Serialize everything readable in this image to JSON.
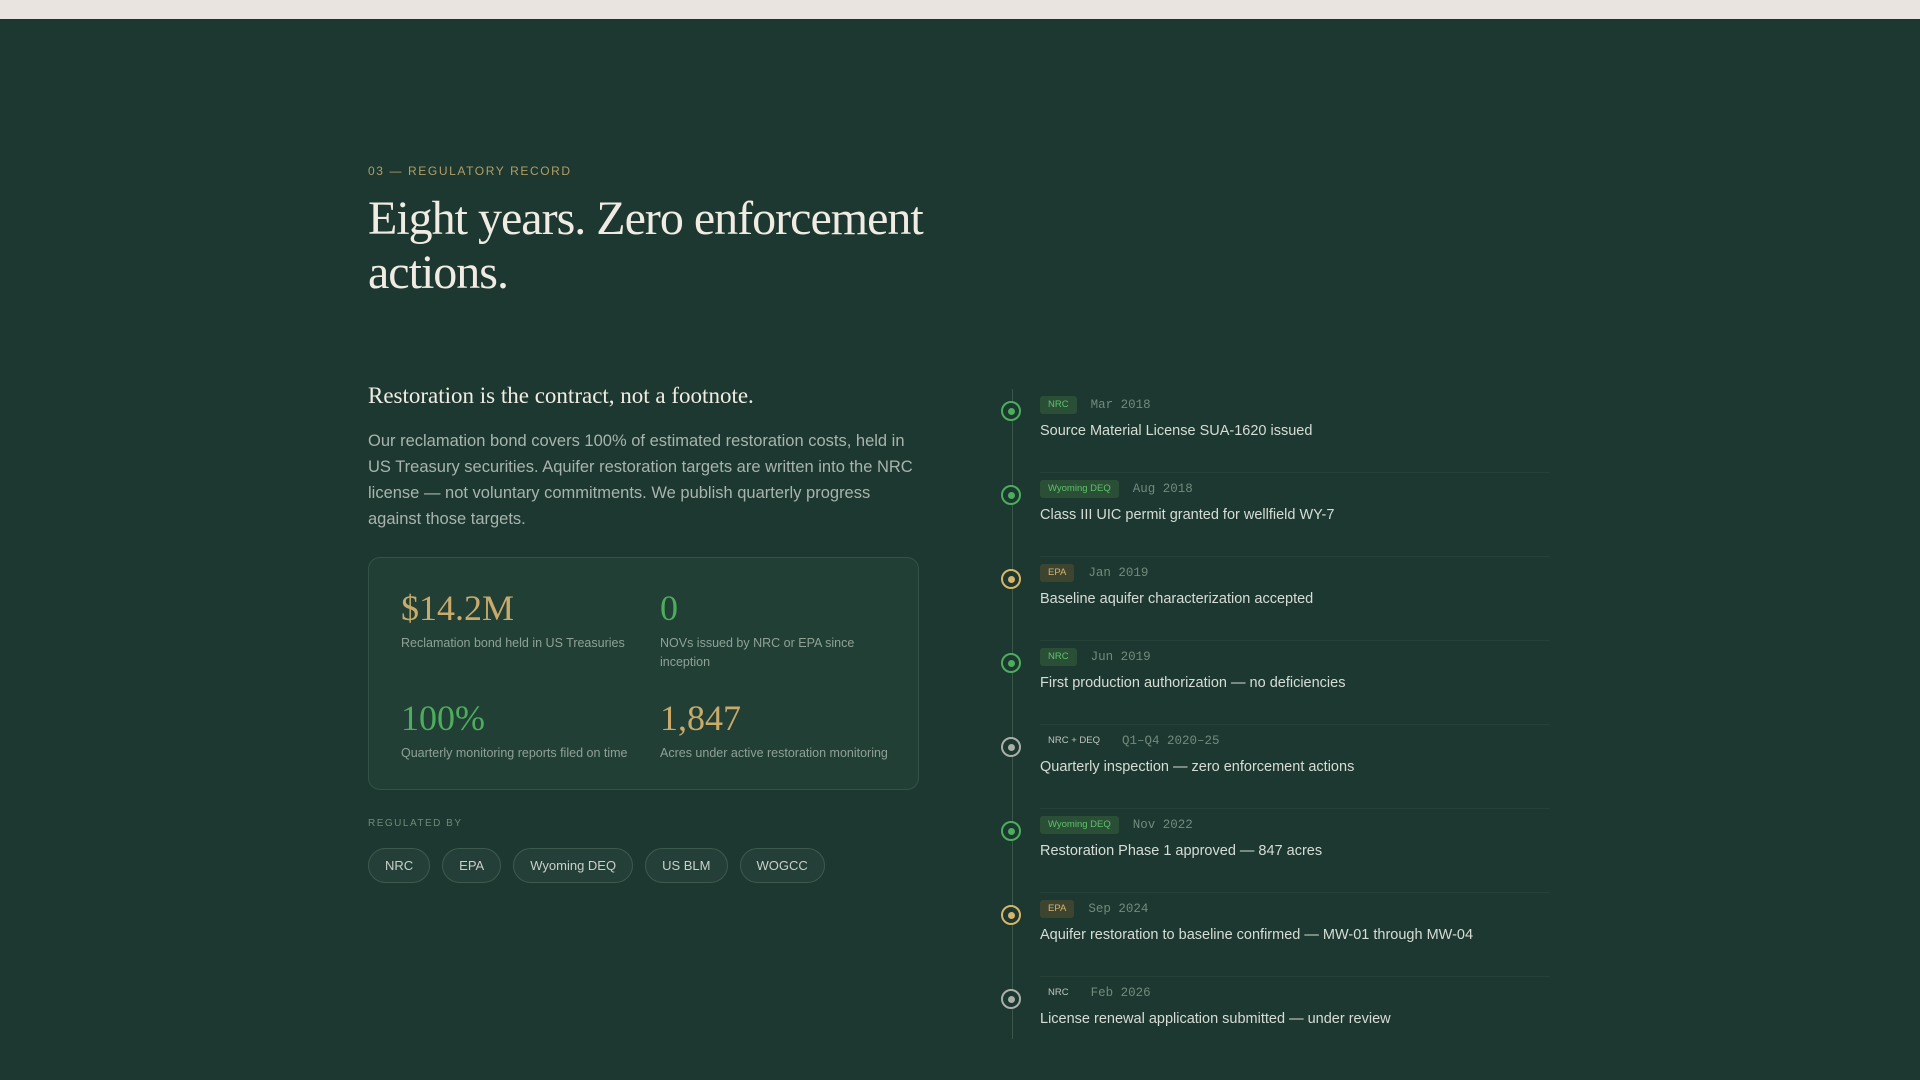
{
  "section": {
    "eyebrow": "03 — REGULATORY RECORD",
    "title": "Eight years. Zero enforcement actions."
  },
  "intro": {
    "heading": "Restoration is the contract, not a footnote.",
    "body": "Our reclamation bond covers 100% of estimated restoration costs, held in US Treasury securities. Aquifer restoration targets are written into the NRC license — not voluntary commitments. We publish quarterly progress against those targets."
  },
  "stats": [
    {
      "value": "$14.2M",
      "label": "Reclamation bond held in US Treasuries",
      "color": "#c8aa6a"
    },
    {
      "value": "0",
      "label": "NOVs issued by NRC or EPA since inception",
      "color": "#4cae5c"
    },
    {
      "value": "100%",
      "label": "Quarterly monitoring reports filed on time",
      "color": "#4cae5c"
    },
    {
      "value": "1,847",
      "label": "Acres under active restoration monitoring",
      "color": "#c8aa6a"
    }
  ],
  "regulators": {
    "label": "REGULATED BY",
    "items": [
      "NRC",
      "EPA",
      "Wyoming DEQ",
      "US BLM",
      "WOGCC"
    ]
  },
  "timeline": [
    {
      "agency": "NRC",
      "date": "Mar 2018",
      "text": "Source Material License SUA-1620 issued",
      "status": "green"
    },
    {
      "agency": "Wyoming DEQ",
      "date": "Aug 2018",
      "text": "Class III UIC permit granted for wellfield WY-7",
      "status": "green"
    },
    {
      "agency": "EPA",
      "date": "Jan 2019",
      "text": "Baseline aquifer characterization accepted",
      "status": "gold"
    },
    {
      "agency": "NRC",
      "date": "Jun 2019",
      "text": "First production authorization — no deficiencies",
      "status": "green"
    },
    {
      "agency": "NRC + DEQ",
      "date": "Q1–Q4 2020–25",
      "text": "Quarterly inspection — zero enforcement actions",
      "status": "gray"
    },
    {
      "agency": "Wyoming DEQ",
      "date": "Nov 2022",
      "text": "Restoration Phase 1 approved — 847 acres",
      "status": "green"
    },
    {
      "agency": "EPA",
      "date": "Sep 2024",
      "text": "Aquifer restoration to baseline confirmed — MW-01 through MW-04",
      "status": "gold"
    },
    {
      "agency": "NRC",
      "date": "Feb 2026",
      "text": "License renewal application submitted — under review",
      "status": "gray"
    }
  ],
  "colors": {
    "background": "#1d3830",
    "accent_gold": "#c8aa6a",
    "accent_green": "#4cae5c",
    "text_light": "#f1ece3"
  }
}
